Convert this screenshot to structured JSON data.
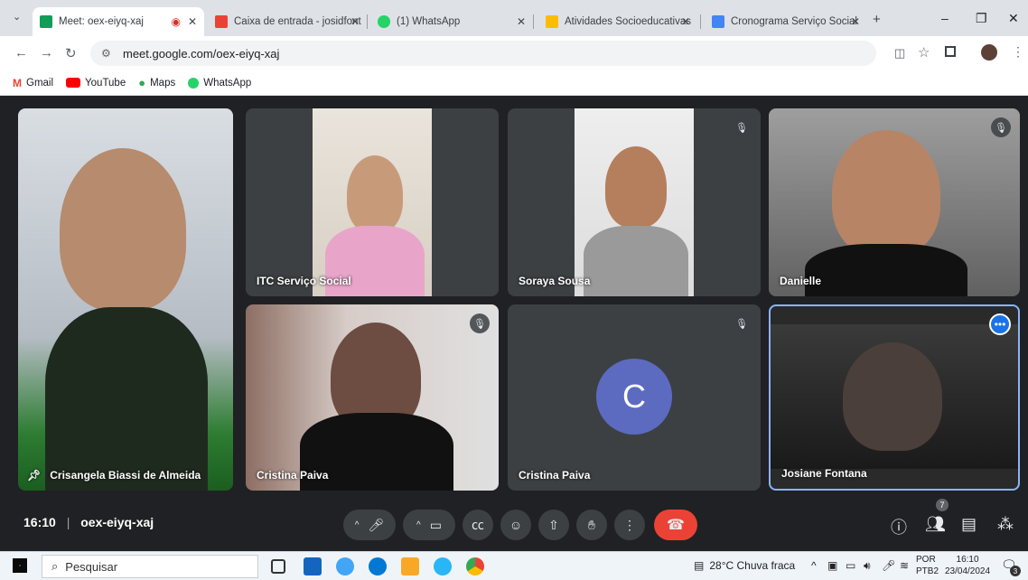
{
  "browser": {
    "tabs": [
      {
        "title": "Meet: oex-eiyq-xaj",
        "color": "#0f9d58"
      },
      {
        "title": "Caixa de entrada - josidfont",
        "color": "#ea4335"
      },
      {
        "title": "(1) WhatsApp",
        "color": "#25d366"
      },
      {
        "title": "Atividades Socioeducativas",
        "color": "#fbbc04"
      },
      {
        "title": "Cronograma Serviço Social",
        "color": "#4285f4"
      }
    ],
    "url": "meet.google.com/oex-eiyq-xaj",
    "bookmarks": [
      {
        "label": "Gmail",
        "icon": "gmail-icon"
      },
      {
        "label": "YouTube",
        "icon": "youtube-icon"
      },
      {
        "label": "Maps",
        "icon": "maps-icon"
      },
      {
        "label": "WhatsApp",
        "icon": "whatsapp-icon"
      }
    ]
  },
  "meet": {
    "participants": [
      {
        "name": "Crisangela Biassi de Almeida",
        "pinned": true
      },
      {
        "name": "ITC Serviço Social"
      },
      {
        "name": "Soraya Sousa",
        "muted": true
      },
      {
        "name": "Danielle",
        "muted": true
      },
      {
        "name": "Cristina Paiva",
        "muted": true
      },
      {
        "name": "Cristina Paiva",
        "muted": true,
        "avatar_letter": "C"
      },
      {
        "name": "Josiane Fontana"
      }
    ],
    "time": "16:10",
    "meeting_code": "oex-eiyq-xaj",
    "people_count": "7",
    "end_call_color": "#ea4335",
    "avatar_color": "#5c6bc0"
  },
  "taskbar": {
    "search_placeholder": "Pesquisar",
    "weather": "28°C  Chuva fraca",
    "lang": "POR",
    "lang_sub": "PTB2",
    "clock_time": "16:10",
    "clock_date": "23/04/2024",
    "notif_count": "3"
  }
}
